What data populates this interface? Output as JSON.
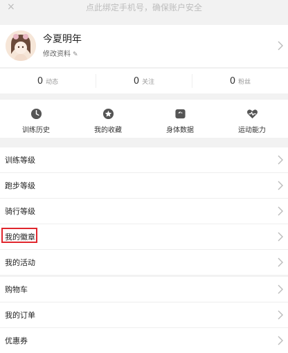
{
  "banner": {
    "close": "×",
    "text": "点此绑定手机号，确保账户安全"
  },
  "profile": {
    "name": "今夏明年",
    "edit_label": "修改资料",
    "edit_icon": "edit-icon"
  },
  "stats": [
    {
      "count": "0",
      "label": "动态"
    },
    {
      "count": "0",
      "label": "关注"
    },
    {
      "count": "0",
      "label": "粉丝"
    }
  ],
  "quick_links": [
    {
      "label": "训练历史",
      "icon": "clock-icon"
    },
    {
      "label": "我的收藏",
      "icon": "star-icon"
    },
    {
      "label": "身体数据",
      "icon": "scale-icon"
    },
    {
      "label": "运动能力",
      "icon": "heartbeat-icon"
    }
  ],
  "menu_1": [
    {
      "label": "训练等级"
    },
    {
      "label": "跑步等级"
    },
    {
      "label": "骑行等级"
    },
    {
      "label": "我的徽章",
      "highlighted": true
    },
    {
      "label": "我的活动"
    }
  ],
  "menu_2": [
    {
      "label": "购物车"
    },
    {
      "label": "我的订单"
    },
    {
      "label": "优惠券"
    }
  ],
  "colors": {
    "highlight": "#e0252c",
    "icon": "#555555",
    "background": "#f2f2f2"
  }
}
